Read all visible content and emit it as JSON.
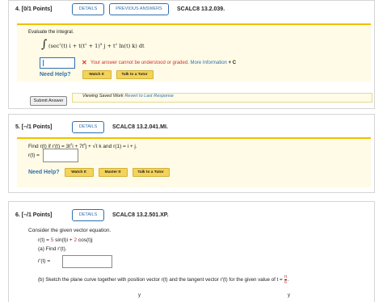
{
  "q4": {
    "points": "4. [0/1 Points]",
    "details": "DETAILS",
    "previous": "PREVIOUS ANSWERS",
    "code": "SCALC8 13.2.039.",
    "prompt": "Evaluate the integral.",
    "integral_pre": "(sec",
    "integral_mid": "(t) i + t(t",
    "integral_mid2": " + 1)",
    "integral_end": " j + t",
    "integral_end2": " ln(t) k) dt",
    "sup2": "2",
    "sup8": "8",
    "answer_value": "",
    "error_text": "Your answer cannot be understood or graded.",
    "more_info": "More Information",
    "need_help": "Need Help?",
    "watch": "Watch It",
    "talk": "Talk to a Tutor",
    "submit": "Submit Answer",
    "viewing": "Viewing Saved Work",
    "revert": "Revert to Last Response"
  },
  "q5": {
    "points": "5. [–/1 Points]",
    "details": "DETAILS",
    "code": "SCALC8 13.2.041.MI.",
    "prompt_a": "Find r(t) if r'(t) = 3t",
    "prompt_b": "i + 7t",
    "prompt_c": "j + ",
    "prompt_d": "t k and r(1) = i + j.",
    "sup2": "2",
    "sup6": "6",
    "r_label": "r(t) =",
    "answer_value": "",
    "need_help": "Need Help?",
    "watch": "Watch It",
    "master": "Master It",
    "talk": "Talk to a Tutor"
  },
  "q6": {
    "points": "6. [–/1 Points]",
    "details": "DETAILS",
    "code": "SCALC8 13.2.501.XP.",
    "prompt": "Consider the given vector equation.",
    "eq_a": "r(t) = ",
    "eq_b": "5",
    "eq_c": " sin(t)i + ",
    "eq_d": "2",
    "eq_e": " cos(t)j",
    "part_a": "(a) Find r'(t).",
    "rp_label": "r'(t) =",
    "answer_value": "",
    "part_b_a": "(b) Sketch the plane curve together with position vector r(t) and the tangent vector r'(t) for the given value of t =",
    "frac_num": "π",
    "frac_den": "6",
    "axis_y": "y"
  },
  "colors": {
    "accent": "#2f6faf",
    "highlight": "#f0c000",
    "error": "#cc3333"
  }
}
